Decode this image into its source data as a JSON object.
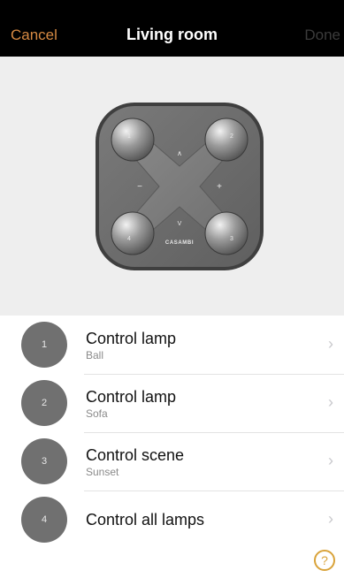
{
  "nav": {
    "cancel_label": "Cancel",
    "title": "Living room",
    "done_label": "Done"
  },
  "device": {
    "button_labels": [
      "1",
      "2",
      "3",
      "4"
    ],
    "up_label": "∧",
    "down_label": "V",
    "minus_label": "−",
    "plus_label": "+",
    "brand": "CASAMBI"
  },
  "list": {
    "items": [
      {
        "number": "1",
        "title": "Control lamp",
        "subtitle": "Ball"
      },
      {
        "number": "2",
        "title": "Control lamp",
        "subtitle": "Sofa"
      },
      {
        "number": "3",
        "title": "Control scene",
        "subtitle": "Sunset"
      },
      {
        "number": "4",
        "title": "Control all lamps",
        "subtitle": ""
      }
    ],
    "chevron": "›"
  },
  "help": {
    "label": "?"
  },
  "colors": {
    "accent": "#d78a43",
    "nav_background": "#000000",
    "device_background": "#eeeeee",
    "badge": "#707070",
    "help": "#d9a33a"
  }
}
